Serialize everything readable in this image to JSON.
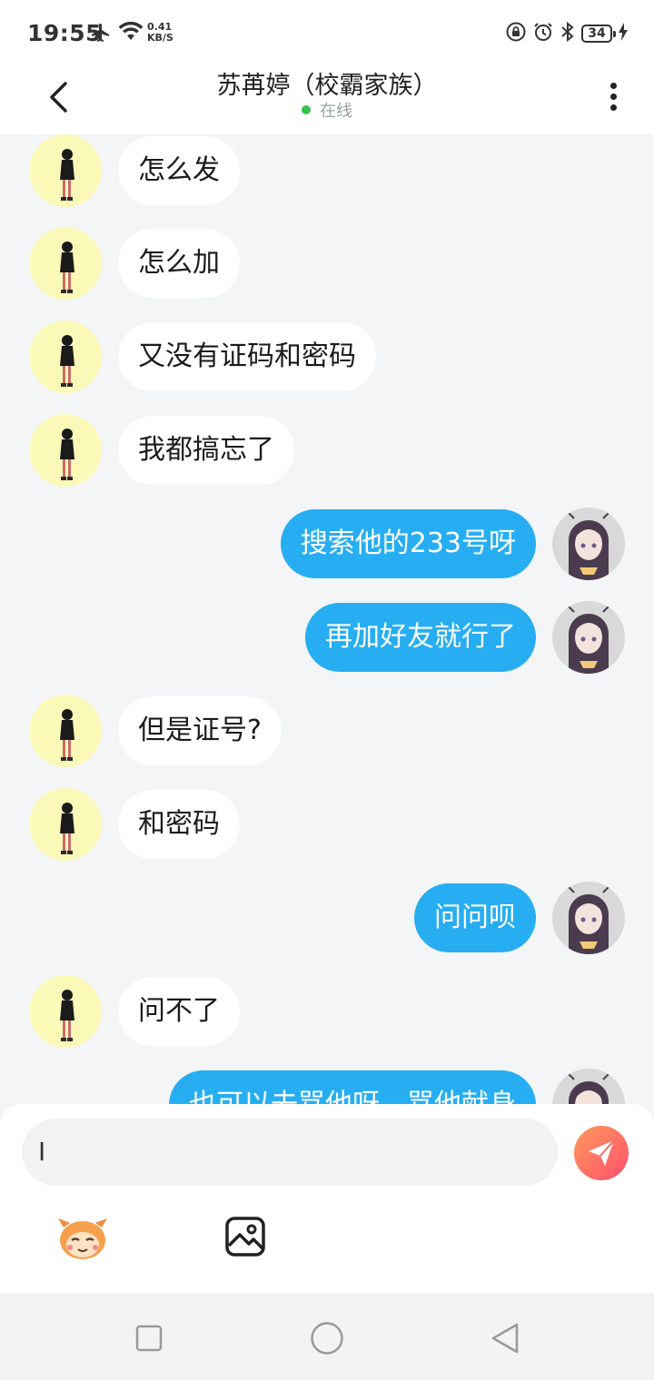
{
  "status_bar": {
    "time": "19:55",
    "speed_value": "0.41",
    "speed_unit": "KB/S",
    "battery": "34"
  },
  "header": {
    "title": "苏苒婷（校霸家族）",
    "presence": "在线"
  },
  "messages": [
    {
      "side": "left",
      "text": "怎么发"
    },
    {
      "side": "left",
      "text": "怎么加"
    },
    {
      "side": "left",
      "text": "又没有证码和密码"
    },
    {
      "side": "left",
      "text": "我都搞忘了"
    },
    {
      "side": "right",
      "text": "搜索他的233号呀"
    },
    {
      "side": "right",
      "text": "再加好友就行了"
    },
    {
      "side": "left",
      "text": "但是证号?"
    },
    {
      "side": "left",
      "text": "和密码"
    },
    {
      "side": "right",
      "text": "问问呗"
    },
    {
      "side": "left",
      "text": "问不了"
    },
    {
      "side": "right",
      "text": "也可以去骂他呀，骂他献身"
    }
  ],
  "composer": {
    "input_value": "I"
  },
  "icons": {
    "back": "back-arrow-icon",
    "more": "more-vertical-icon",
    "send": "paper-plane-icon",
    "emoji": "mascot-emoji-icon",
    "image": "image-icon",
    "nav": [
      "recent-apps-square-icon",
      "home-circle-icon",
      "back-triangle-icon"
    ]
  },
  "colors": {
    "outgoing_bubble": "#27aef2",
    "incoming_bubble": "#ffffff",
    "online_dot": "#35c24b",
    "send_button": "#ff6a62"
  }
}
